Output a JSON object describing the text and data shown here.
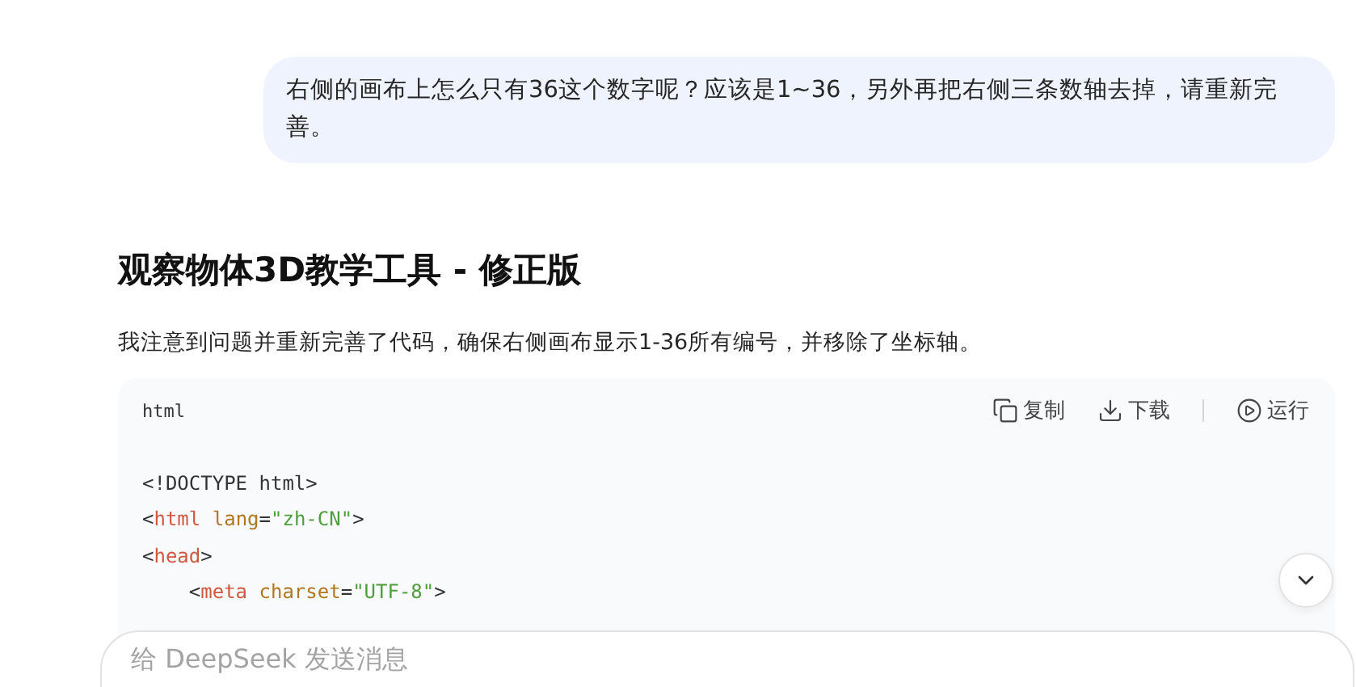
{
  "user_message": "右侧的画布上怎么只有36这个数字呢？应该是1~36，另外再把右侧三条数轴去掉，请重新完善。",
  "answer": {
    "title": "观察物体3D教学工具 - 修正版",
    "intro": "我注意到问题并重新完善了代码，确保右侧画布显示1-36所有编号，并移除了坐标轴。"
  },
  "code_block": {
    "language": "html",
    "actions": [
      {
        "kind": "copy",
        "label": "复制"
      },
      {
        "kind": "download",
        "label": "下载"
      },
      {
        "kind": "run",
        "label": "运行"
      }
    ],
    "lines": [
      {
        "tokens": [
          {
            "kind": "plain",
            "text": "<!DOCTYPE html>"
          }
        ]
      },
      {
        "tokens": [
          {
            "kind": "plain",
            "text": "<"
          },
          {
            "kind": "tag",
            "text": "html"
          },
          {
            "kind": "attr",
            "text": " lang"
          },
          {
            "kind": "plain",
            "text": "="
          },
          {
            "kind": "str",
            "text": "\"zh-CN\""
          },
          {
            "kind": "plain",
            "text": ">"
          }
        ]
      },
      {
        "tokens": [
          {
            "kind": "plain",
            "text": "<"
          },
          {
            "kind": "tag",
            "text": "head"
          },
          {
            "kind": "plain",
            "text": ">"
          }
        ]
      },
      {
        "tokens": [
          {
            "kind": "plain",
            "text": "    <"
          },
          {
            "kind": "tag",
            "text": "meta"
          },
          {
            "kind": "attr",
            "text": " charset"
          },
          {
            "kind": "plain",
            "text": "="
          },
          {
            "kind": "str",
            "text": "\"UTF-8\""
          },
          {
            "kind": "plain",
            "text": ">"
          }
        ]
      }
    ]
  },
  "composer": {
    "placeholder": "给 DeepSeek 发送消息"
  }
}
